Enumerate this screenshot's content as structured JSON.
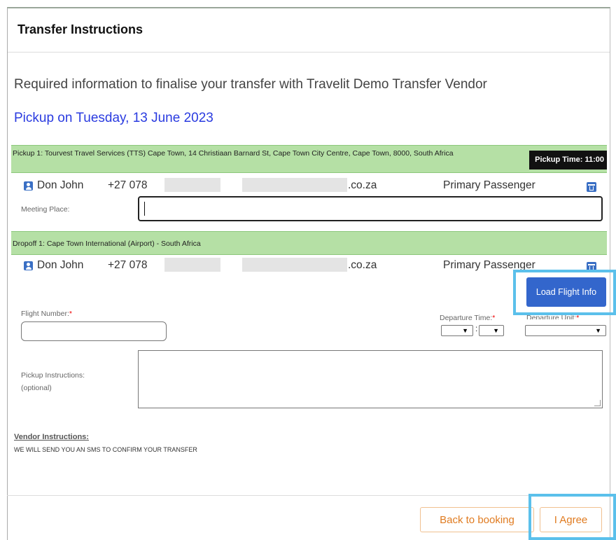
{
  "modal": {
    "title": "Transfer Instructions"
  },
  "intro": "Required information to finalise your transfer with Travelit Demo Transfer Vendor",
  "pickup_date": "Pickup on Tuesday, 13 June 2023",
  "pickup_bar": {
    "text": "Pickup 1: Tourvest Travel Services (TTS) Cape Town, 14 Christiaan Barnard St, Cape Town City Centre, Cape Town, 8000, South Africa",
    "time": "Pickup Time: 11:00"
  },
  "passenger": {
    "name": "Don John",
    "phone": "+27 078",
    "email_suffix": ".co.za",
    "role": "Primary Passenger"
  },
  "meeting_place": {
    "label": "Meeting Place:",
    "value": ""
  },
  "dropoff_bar": {
    "text": "Dropoff 1: Cape Town International (Airport) - South Africa"
  },
  "load_flight_btn": "Load Flight Info",
  "flight_number": {
    "label": "Flight Number:",
    "required": "*",
    "value": ""
  },
  "departure_time": {
    "label": "Departure Time:",
    "required": "*",
    "separator": ":"
  },
  "departure_unit": {
    "label": "Departure Unit:",
    "required": "*"
  },
  "chevron": "▼",
  "pickup_instructions": {
    "label": "Pickup Instructions:",
    "sublabel": "(optional)",
    "value": ""
  },
  "vendor": {
    "title": "Vendor Instructions:",
    "text": "WE WILL SEND YOU AN SMS TO CONFIRM YOUR TRANSFER"
  },
  "footer": {
    "back": "Back to booking",
    "agree": "I Agree"
  },
  "colors": {
    "accent_blue": "#3366cc",
    "highlight": "#5bc0eb",
    "bar_green": "#b5e0a5",
    "date_blue": "#2a3be0",
    "orange": "#e07b20"
  }
}
